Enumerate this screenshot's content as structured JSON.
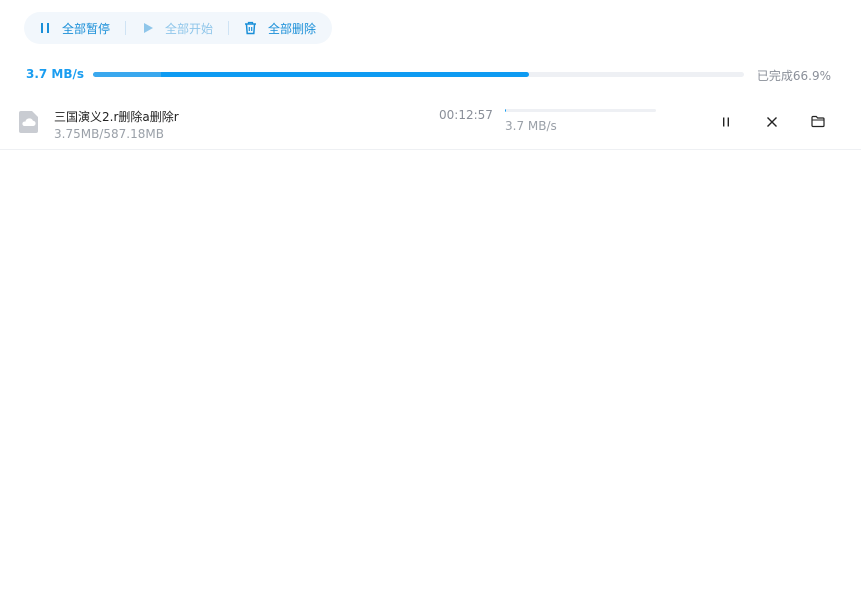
{
  "toolbar": {
    "pause_all_label": "全部暂停",
    "start_all_label": "全部开始",
    "delete_all_label": "全部删除"
  },
  "overall": {
    "speed": "3.7 MB/s",
    "progress_fraction": 0.669,
    "status": "已完成66.9%"
  },
  "downloads": [
    {
      "name": "三国演义2.r删除a删除r",
      "size": "3.75MB/587.18MB",
      "time_left": "00:12:57",
      "progress_fraction": 0.0064,
      "speed": "3.7 MB/s"
    }
  ],
  "colors": {
    "accent": "#0e9bf2",
    "toolbar_bg": "#f2f7fc",
    "disabled": "#8fc6ea"
  },
  "icons": {
    "pause_all": "pause-icon",
    "start_all": "play-icon",
    "delete_all": "trash-icon",
    "file": "cloud-file-icon",
    "row_pause": "pause-icon",
    "row_cancel": "close-icon",
    "row_folder": "folder-icon"
  }
}
